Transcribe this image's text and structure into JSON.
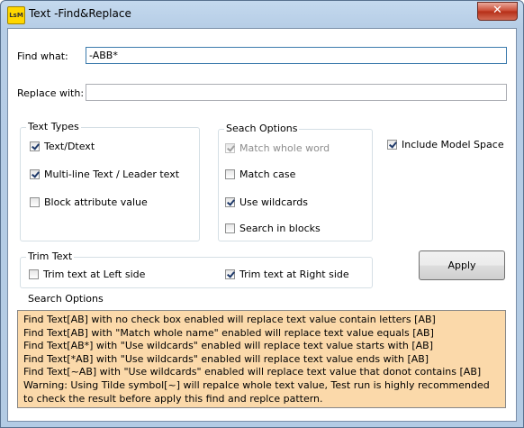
{
  "window": {
    "title": "Text -Find&Replace",
    "app_icon": "LsM",
    "close_glyph": "✕"
  },
  "find": {
    "label": "Find what:",
    "value": "-ABB*"
  },
  "replace": {
    "label": "Replace with:",
    "value": ""
  },
  "text_types": {
    "title": "Text Types",
    "items": [
      {
        "label": "Text/Dtext",
        "checked": true
      },
      {
        "label": "Multi-line Text / Leader text",
        "checked": true
      },
      {
        "label": "Block attribute value",
        "checked": false
      }
    ]
  },
  "search_options": {
    "title": "Seach Options",
    "items": [
      {
        "label": "Match whole word",
        "checked": true,
        "disabled": true
      },
      {
        "label": "Match case",
        "checked": false
      },
      {
        "label": "Use wildcards",
        "checked": true
      },
      {
        "label": "Search in blocks",
        "checked": false
      }
    ]
  },
  "include_model_space": {
    "label": "Include Model Space",
    "checked": true
  },
  "trim_text": {
    "title": "Trim Text",
    "left": {
      "label": "Trim text at Left side",
      "checked": false
    },
    "right": {
      "label": "Trim text at Right side",
      "checked": true
    }
  },
  "apply_label": "Apply",
  "info": {
    "title": "Search Options",
    "lines": [
      "Find Text[AB] with no check box enabled will replace text value contain letters [AB]",
      "Find Text[AB] with \"Match whole name\" enabled will replace text value equals [AB]",
      "Find Text[AB*] with \"Use wildcards\" enabled will replace text value starts with [AB]",
      "Find Text[*AB] with \"Use wildcards\" enabled will replace text value ends with [AB]",
      "Find Text[~AB] with \"Use wildcards\" enabled will replace text value that donot contains [AB]",
      "Warning: Using Tilde symbol[~] will repalce whole text value, Test run is highly recommended",
      "to check the result before apply this find and replce pattern."
    ]
  }
}
